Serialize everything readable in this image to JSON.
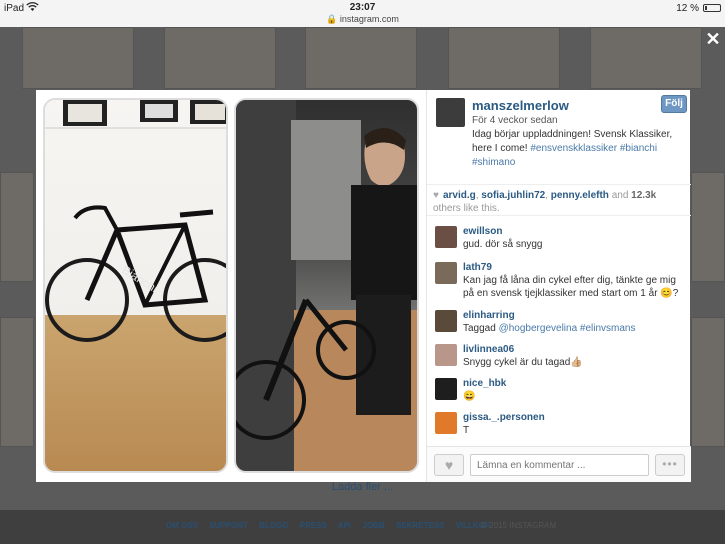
{
  "status_bar": {
    "device": "iPad",
    "time": "23:07",
    "url": "instagram.com",
    "battery": "12 %"
  },
  "background": {
    "load_more": "Ladda fler ...",
    "footer_links": [
      "OM OSS",
      "SUPPORT",
      "BLOGG",
      "PRESS",
      "API",
      "JOBB",
      "SEKRETESS",
      "VILLKOR"
    ],
    "copyright": "© 2015 INSTAGRAM"
  },
  "icons": {
    "close": "close-icon",
    "wifi": "wifi-icon",
    "lock": "lock-icon",
    "heart": "heart-icon",
    "more": "more-icon"
  },
  "post": {
    "username": "manszelmerlow",
    "follow_label": "Följ",
    "time": "För 4 veckor sedan",
    "caption_text": "Idag börjar uppladdningen! Svensk Klassiker, here I come! ",
    "caption_tags": "#ensvenskklassiker #bianchi #shimano",
    "likes": {
      "users": [
        "arvid.g",
        "sofia.juhlin72",
        "penny.elefth"
      ],
      "and_word": "and",
      "count": "12.3k",
      "others": "others like this."
    },
    "comments": [
      {
        "user": "ewillson",
        "text": "gud. dör så snygg",
        "tags": "",
        "avatar_color": "#6b4f45"
      },
      {
        "user": "lath79",
        "text": "Kan jag få låna din cykel efter dig, tänkte ge mig på en svensk tjejklassiker med start om 1 år 😊?",
        "tags": "",
        "avatar_color": "#7a6a5a"
      },
      {
        "user": "elinharring",
        "text": "Taggad ",
        "tags": "@hogbergevelina #elinvsmans",
        "avatar_color": "#5a4a3a"
      },
      {
        "user": "livlinnea06",
        "text": "Snygg cykel är du tagad👍🏼",
        "tags": "",
        "avatar_color": "#b8968a"
      },
      {
        "user": "nice_hbk",
        "text": "😄",
        "tags": "",
        "avatar_color": "#1e1e1e"
      },
      {
        "user": "gissa._.personen",
        "text": "T",
        "tags": "",
        "avatar_color": "#e07a2a"
      }
    ],
    "comment_placeholder": "Lämna en kommentar ..."
  },
  "accent_colors": {
    "link": "#2b5a83",
    "follow_button": "#6f97c4",
    "hashtag": "#4a7aa8"
  }
}
